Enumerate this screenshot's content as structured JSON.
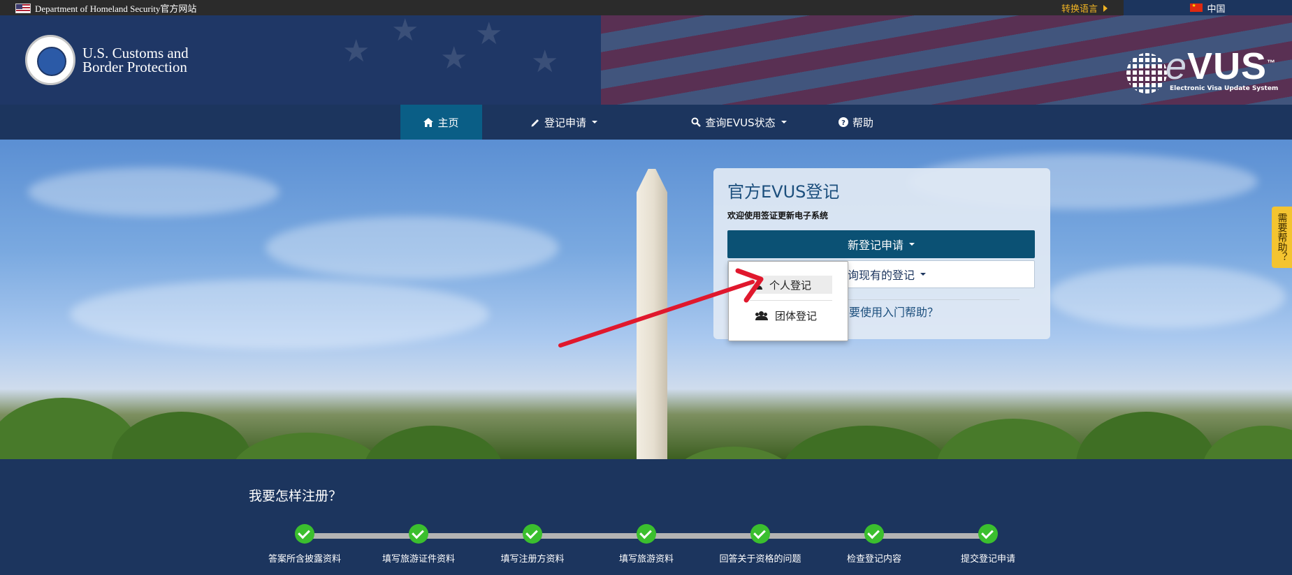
{
  "topbar": {
    "dhs_label": "Department of Homeland Security官方网站",
    "switch_language": "转换语言",
    "current_language": "中国"
  },
  "header": {
    "agency_line1": "U.S. Customs and",
    "agency_line2": "Border Protection",
    "logo_text_e": "e",
    "logo_text_rest": "VUS",
    "logo_tm": "™",
    "logo_tagline": "Electronic Visa Update System"
  },
  "nav": {
    "items": [
      {
        "label": "主页",
        "icon": "home-icon",
        "active": true
      },
      {
        "label": "登记申请",
        "icon": "pencil-icon",
        "dropdown": true
      },
      {
        "label": "查询EVUS状态",
        "icon": "search-icon",
        "dropdown": true
      },
      {
        "label": "帮助",
        "icon": "question-circle-icon"
      }
    ]
  },
  "card": {
    "title": "官方EVUS登记",
    "subtitle": "欢迎使用签证更新电子系统",
    "new_enrollment_button": "新登记申请",
    "query_existing_button": "查询现有的登记",
    "help_link": "需要使用入门帮助？"
  },
  "dropdown": {
    "items": [
      {
        "label": "个人登记",
        "icon": "user-icon"
      },
      {
        "label": "团体登记",
        "icon": "users-icon"
      }
    ]
  },
  "side_help_tab": "需要帮助？",
  "how_to": {
    "title": "我要怎样注册？",
    "steps": [
      "答案所含披露资料",
      "填写旅游证件资料",
      "填写注册方资料",
      "填写旅游资料",
      "回答关于资格的问题",
      "检查登记内容",
      "提交登记申请"
    ]
  },
  "colors": {
    "navy": "#1c355e",
    "active_nav": "#0a5e86",
    "primary_button": "#0b5174",
    "annotation_arrow": "#e0182d",
    "step_check": "#3bbf2e",
    "help_tab": "#f4c430"
  }
}
